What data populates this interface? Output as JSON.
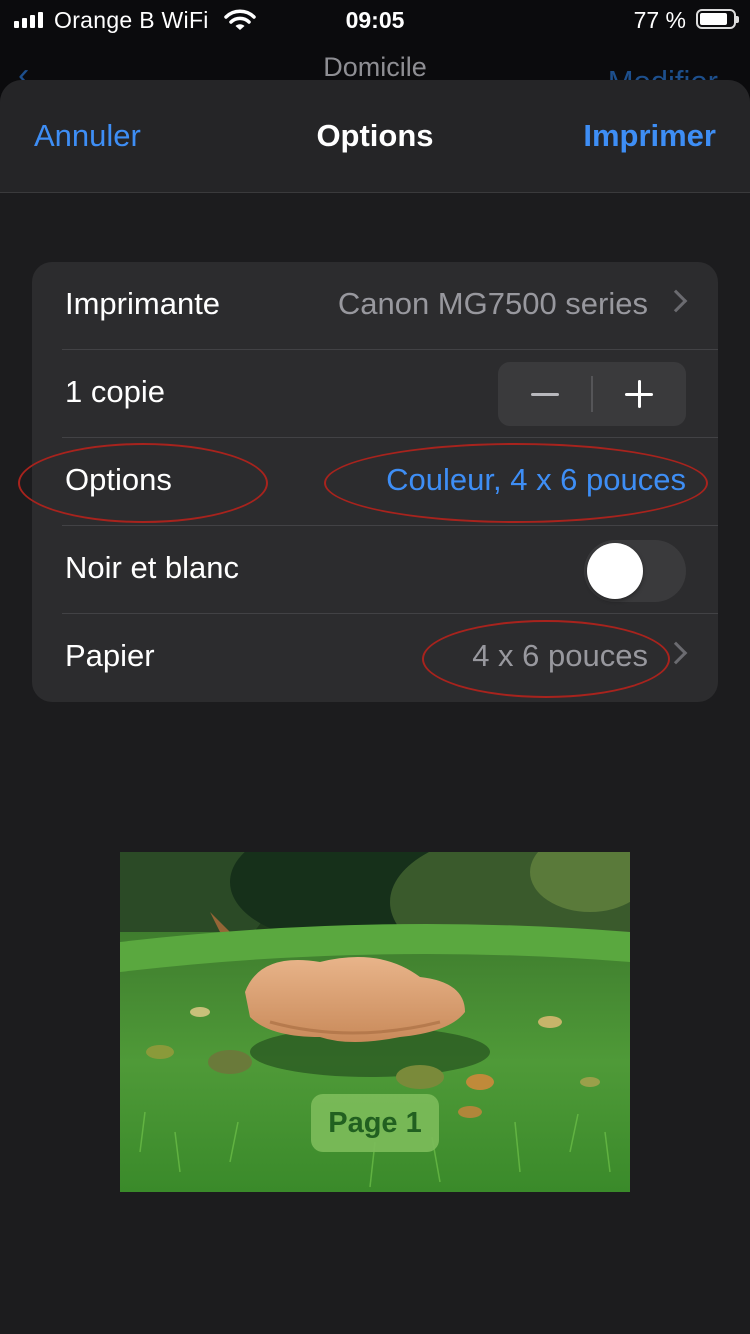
{
  "status_bar": {
    "carrier": "Orange B WiFi",
    "time": "09:05",
    "battery": "77 %"
  },
  "background_nav": {
    "title": "Domicile",
    "edit_label": "Modifier"
  },
  "sheet": {
    "cancel_label": "Annuler",
    "title": "Options",
    "print_label": "Imprimer"
  },
  "settings": {
    "printer_label": "Imprimante",
    "printer_value": "Canon MG7500 series",
    "copies_label": "1 copie",
    "options_label": "Options",
    "options_value": "Couleur, 4 x 6 pouces",
    "bw_label": "Noir et blanc",
    "bw_enabled": false,
    "paper_label": "Papier",
    "paper_value": "4 x 6 pouces"
  },
  "preview": {
    "page_label": "Page 1"
  },
  "colors": {
    "accent": "#3e8ef5",
    "annotation": "#a8231d"
  }
}
